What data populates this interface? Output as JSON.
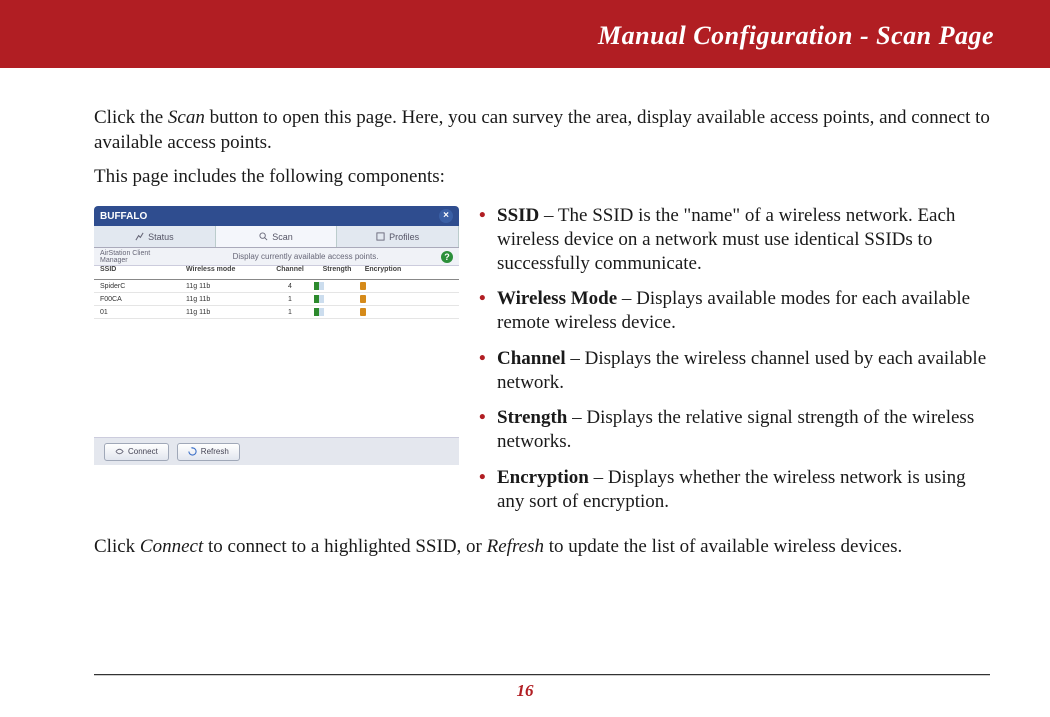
{
  "header": {
    "title": "Manual Configuration - Scan Page"
  },
  "intro": {
    "pre": "Click the ",
    "italic1": "Scan",
    "post": " button to open this page. Here, you can survey the area, display available access points, and connect to available access points."
  },
  "intro2": "This page includes the following components:",
  "screenshot": {
    "brand": "BUFFALO",
    "close": "×",
    "tabs": {
      "status": "Status",
      "scan": "Scan",
      "profiles": "Profiles"
    },
    "subtitle_left": "AirStation Client Manager",
    "subtitle_right": "Display currently available access points.",
    "help": "?",
    "cols": {
      "ssid": "SSID",
      "mode": "Wireless mode",
      "ch": "Channel",
      "str": "Strength",
      "enc": "Encryption"
    },
    "rows": [
      {
        "ssid": "SpiderC",
        "mode": "11g 11b",
        "ch": "4"
      },
      {
        "ssid": "F00CA",
        "mode": "11g 11b",
        "ch": "1"
      },
      {
        "ssid": "01",
        "mode": "11g 11b",
        "ch": "1"
      }
    ],
    "btn_connect": "Connect",
    "btn_refresh": "Refresh"
  },
  "bullets": [
    {
      "term": "SSID",
      "desc": " – The SSID is the \"name\" of a wireless network. Each wireless device on a network must use identical SSIDs to successfully communicate."
    },
    {
      "term": "Wireless Mode",
      "desc": " – Displays available modes for each available remote wireless device."
    },
    {
      "term": "Channel",
      "desc": " – Displays the wireless channel used by each available network."
    },
    {
      "term": "Strength",
      "desc": " – Displays the relative signal strength of the wireless networks."
    },
    {
      "term": "Encryption",
      "desc": " – Displays whether the wireless network is using any sort of encryption."
    }
  ],
  "closing": {
    "p1": "Click ",
    "i1": "Connect",
    "p2": " to connect to a highlighted SSID, or ",
    "i2": "Refresh",
    "p3": " to update the list of available wireless devices."
  },
  "page_number": "16"
}
